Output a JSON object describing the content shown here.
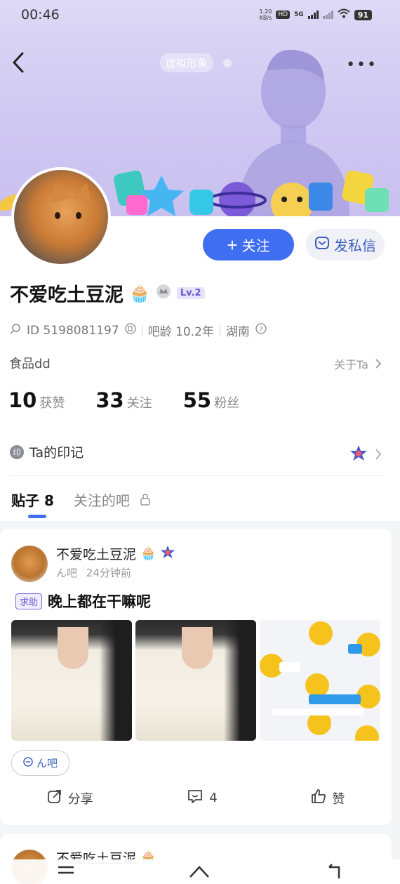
{
  "status_bar": {
    "time": "00:46",
    "net_speed": "1.20\nKB/s",
    "hd": "HD",
    "network": "5G",
    "battery": "91"
  },
  "header": {
    "virtual_label": "虚拟形象",
    "more": "•••"
  },
  "profile": {
    "username": "不爱吃土豆泥",
    "level": "Lv.2",
    "id_text": "ID 5198081197",
    "bar_age": "吧龄 10.2年",
    "location": "湖南",
    "bio": "食品dd",
    "about": "关于Ta",
    "follow_label": "关注",
    "dm_label": "发私信"
  },
  "stats": [
    {
      "num": "10",
      "label": "获赞"
    },
    {
      "num": "33",
      "label": "关注"
    },
    {
      "num": "55",
      "label": "粉丝"
    }
  ],
  "imprint": {
    "icon_text": "印",
    "label": "Ta的印记"
  },
  "tabs": [
    {
      "label": "贴子 8",
      "active": true
    },
    {
      "label": "关注的吧",
      "active": false
    }
  ],
  "post": {
    "author": "不爱吃土豆泥",
    "bar": "ん吧",
    "time": "24分钟前",
    "tag": "求助",
    "title": "晚上都在干嘛呢",
    "bar_tag": "ん吧",
    "share": "分享",
    "comments": "4",
    "like": "赞"
  },
  "post2": {
    "author": "不爱吃土豆泥"
  },
  "colors": {
    "accent": "#3f6ef0",
    "banner": "#cfc8f2"
  }
}
